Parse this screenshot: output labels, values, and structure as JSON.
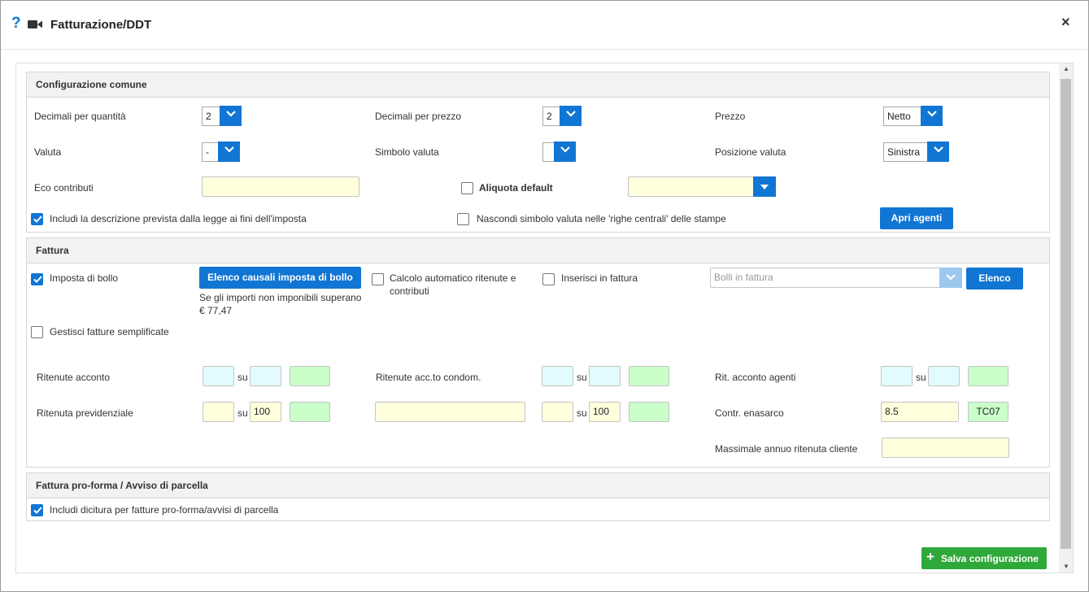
{
  "dialog": {
    "title": "Fatturazione/DDT",
    "help_icon": "question-mark-icon",
    "video_icon": "video-camera-icon",
    "close_icon": "close-icon",
    "help_glyph": "?",
    "close_glyph": "×"
  },
  "colors": {
    "accent": "#1176d3",
    "save_green": "#2fa83a",
    "field_yellow": "#ffffde",
    "field_cyan": "#e2fbff",
    "field_green": "#caffca",
    "panel_header": "#f2f2f2"
  },
  "config_comune": {
    "header": "Configurazione comune",
    "decimali_quantita": {
      "label": "Decimali per quantità",
      "value": "2"
    },
    "decimali_prezzo": {
      "label": "Decimali per prezzo",
      "value": "2"
    },
    "prezzo": {
      "label": "Prezzo",
      "value": "Netto"
    },
    "valuta": {
      "label": "Valuta",
      "value": "-"
    },
    "simbolo_valuta": {
      "label": "Simbolo valuta",
      "value": ""
    },
    "posizione_valuta": {
      "label": "Posizione valuta",
      "value": "Sinistra"
    },
    "eco_contributi": {
      "label": "Eco contributi",
      "value": ""
    },
    "aliquota_default": {
      "label": "Aliquota default",
      "checked": false,
      "value": ""
    },
    "includi_descrizione": {
      "label": "Includi la descrizione prevista dalla legge ai fini dell'imposta",
      "checked": true
    },
    "nascondi_simbolo": {
      "label": "Nascondi simbolo valuta nelle 'righe centrali' delle stampe",
      "checked": false
    },
    "apri_agenti_label": "Apri agenti"
  },
  "fattura": {
    "header": "Fattura",
    "imposta_bollo": {
      "label": "Imposta di bollo",
      "checked": true
    },
    "elenco_causali_label": "Elenco causali imposta di bollo",
    "bollo_note_1": "Se gli importi non imponibili superano",
    "bollo_note_2": "€ 77,47",
    "calcolo_auto": {
      "label_1": "Calcolo automatico ritenute e",
      "label_2": "contributi",
      "checked": false
    },
    "inserisci_fattura": {
      "label": "Inserisci in fattura",
      "checked": false
    },
    "bolli_placeholder": "Bolli in fattura",
    "elenco_label": "Elenco",
    "gestisci_semplificate": {
      "label": "Gestisci fatture semplificate",
      "checked": false
    },
    "su_label": "su",
    "ritenute_acconto": {
      "label": "Ritenute acconto",
      "a": "",
      "b": "",
      "c": ""
    },
    "ritenute_condom": {
      "label": "Ritenute acc.to condom.",
      "a": "",
      "b": "",
      "c": ""
    },
    "rit_agenti": {
      "label": "Rit. acconto agenti",
      "a": "",
      "b": "",
      "c": ""
    },
    "ritenuta_prev": {
      "label": "Ritenuta previdenziale",
      "a": "",
      "b": "100",
      "c": ""
    },
    "prev_extra": {
      "desc": "",
      "a": "",
      "b": "100",
      "c": ""
    },
    "contr_enasarco": {
      "label": "Contr. enasarco",
      "value": "8.5",
      "code": "TC07"
    },
    "massimale": {
      "label": "Massimale annuo ritenuta cliente",
      "value": ""
    }
  },
  "proforma": {
    "header": "Fattura pro-forma / Avviso di parcella",
    "includi_dicitura": {
      "label": "Includi dicitura per fatture pro-forma/avvisi di parcella",
      "checked": true
    }
  },
  "footer": {
    "save_label": "Salva configurazione",
    "save_icon": "plus-icon",
    "save_glyph": "+"
  }
}
